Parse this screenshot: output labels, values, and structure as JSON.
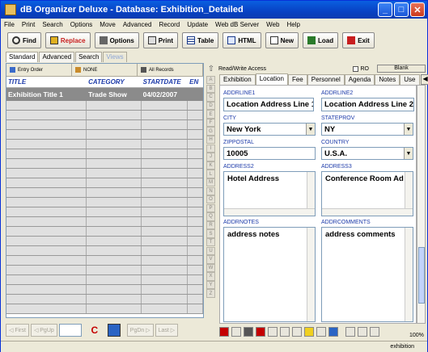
{
  "window": {
    "title": "dB Organizer Deluxe - Database: Exhibition_Detailed"
  },
  "menu": [
    "File",
    "Print",
    "Search",
    "Options",
    "Move",
    "Advanced",
    "Record",
    "Update",
    "Web dB Server",
    "Web",
    "Help"
  ],
  "toolbar": {
    "find": "Find",
    "replace": "Replace",
    "options": "Options",
    "print": "Print",
    "table": "Table",
    "html": "HTML",
    "new": "New",
    "load": "Load",
    "exit": "Exit"
  },
  "view_tabs": [
    "Standard",
    "Advanced",
    "Search",
    "Views"
  ],
  "sort_bar": {
    "order": "Entry Order",
    "filter": "NONE",
    "records": "All Records"
  },
  "grid": {
    "columns": [
      "TITLE",
      "CATEGORY",
      "STARTDATE",
      "EN"
    ],
    "rows": [
      {
        "title": "Exhibition Title 1",
        "category": "Trade Show",
        "startdate": "04/02/2007"
      }
    ]
  },
  "nav": {
    "first": "First",
    "pgup": "PgUp",
    "pgdn": "PgDn",
    "last": "Last"
  },
  "alphabet": [
    "A",
    "B",
    "C",
    "D",
    "E",
    "F",
    "G",
    "H",
    "I",
    "J",
    "K",
    "L",
    "M",
    "N",
    "O",
    "P",
    "Q",
    "R",
    "S",
    "T",
    "U",
    "V",
    "W",
    "X",
    "Y",
    "Z"
  ],
  "access": {
    "label": "Read/Write Access",
    "ro": "RO",
    "blank": "Blank"
  },
  "form_tabs": [
    "Exhibition",
    "Location",
    "Fee",
    "Personnel",
    "Agenda",
    "Notes",
    "Use"
  ],
  "form": {
    "addrline1": {
      "label": "ADDRLINE1",
      "value": "Location Address Line 1"
    },
    "addrline2": {
      "label": "ADDRLINE2",
      "value": "Location Address Line 2"
    },
    "city": {
      "label": "CITY",
      "value": "New York"
    },
    "stateprov": {
      "label": "STATEPROV",
      "value": "NY"
    },
    "zippostal": {
      "label": "ZIPPOSTAL",
      "value": "10005"
    },
    "country": {
      "label": "COUNTRY",
      "value": "U.S.A."
    },
    "address2": {
      "label": "ADDRESS2",
      "value": "Hotel Address"
    },
    "address3": {
      "label": "ADDRESS3",
      "value": "Conference Room Ad"
    },
    "addrnotes": {
      "label": "ADDRNOTES",
      "value": "address notes"
    },
    "addrcomments": {
      "label": "ADDRCOMMENTS",
      "value": "address comments"
    }
  },
  "status": {
    "zoom": "100%",
    "db": "exhibition"
  }
}
